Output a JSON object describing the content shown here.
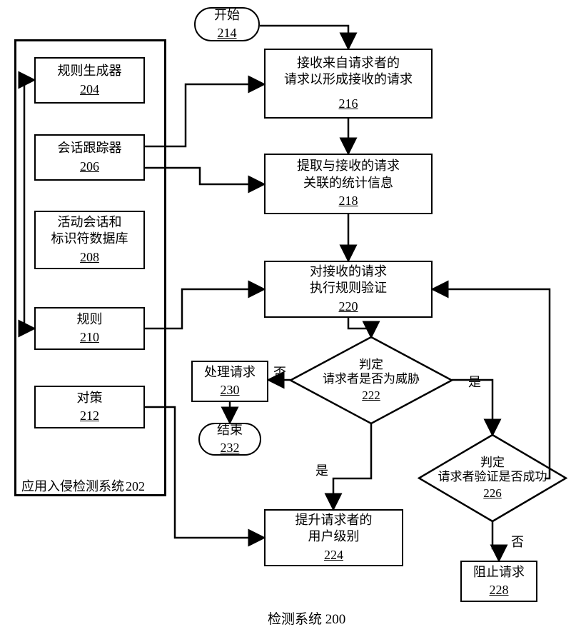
{
  "system_frame": {
    "label": "应用入侵检测系统",
    "num": "202"
  },
  "left_boxes": {
    "b204": {
      "label": "规则生成器",
      "num": "204"
    },
    "b206": {
      "label": "会话跟踪器",
      "num": "206"
    },
    "b208": {
      "label": "活动会话和\n标识符数据库",
      "num": "208"
    },
    "b210": {
      "label": "规则",
      "num": "210"
    },
    "b212": {
      "label": "对策",
      "num": "212"
    }
  },
  "flow": {
    "start": {
      "label": "开始",
      "num": "214"
    },
    "n216": {
      "label": "接收来自请求者的\n请求以形成接收的请求",
      "num": "216"
    },
    "n218": {
      "label": "提取与接收的请求\n关联的统计信息",
      "num": "218"
    },
    "n220": {
      "label": "对接收的请求\n执行规则验证",
      "num": "220"
    },
    "d222": {
      "label": "判定\n请求者是否为威胁",
      "num": "222"
    },
    "n224": {
      "label": "提升请求者的\n用户级别",
      "num": "224"
    },
    "d226": {
      "label": "判定\n请求者验证是否成功",
      "num": "226"
    },
    "n228": {
      "label": "阻止请求",
      "num": "228"
    },
    "n230": {
      "label": "处理请求",
      "num": "230"
    },
    "end": {
      "label": "结束",
      "num": "232"
    }
  },
  "branch": {
    "no": "否",
    "yes": "是"
  },
  "caption": "检测系统 200"
}
